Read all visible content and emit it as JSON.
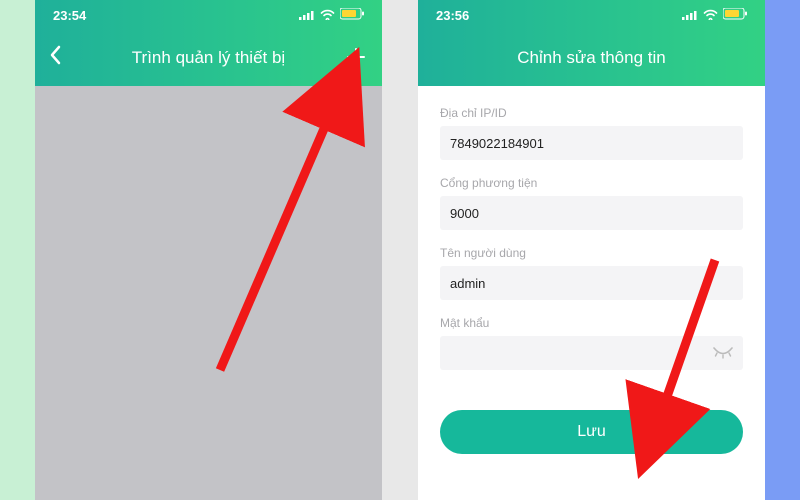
{
  "left": {
    "status_time": "23:54",
    "title": "Trình quản lý thiết bị"
  },
  "right": {
    "status_time": "23:56",
    "title": "Chỉnh sửa thông tin",
    "form": {
      "ip_label": "Địa chỉ IP/ID",
      "ip_value": "7849022184901",
      "port_label": "Cổng phương tiện",
      "port_value": "9000",
      "user_label": "Tên người dùng",
      "user_value": "admin",
      "pass_label": "Mật khẩu",
      "pass_value": ""
    },
    "save_label": "Lưu"
  }
}
